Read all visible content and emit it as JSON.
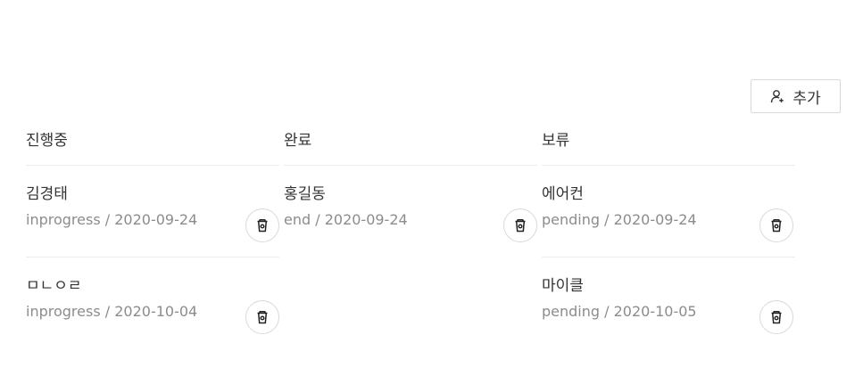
{
  "toolbar": {
    "add_label": "추가",
    "add_icon": "user-add-icon"
  },
  "delete_icon": "delete-cup-icon",
  "columns": [
    {
      "title": "진행중",
      "tasks": [
        {
          "name": "김경태",
          "meta": "inprogress / 2020-09-24"
        },
        {
          "name": "ㅁㄴㅇㄹ",
          "meta": "inprogress / 2020-10-04"
        }
      ]
    },
    {
      "title": "완료",
      "tasks": [
        {
          "name": "홍길동",
          "meta": "end / 2020-09-24"
        }
      ]
    },
    {
      "title": "보류",
      "tasks": [
        {
          "name": "에어컨",
          "meta": "pending / 2020-09-24"
        },
        {
          "name": "마이클",
          "meta": "pending / 2020-10-05"
        }
      ]
    }
  ]
}
